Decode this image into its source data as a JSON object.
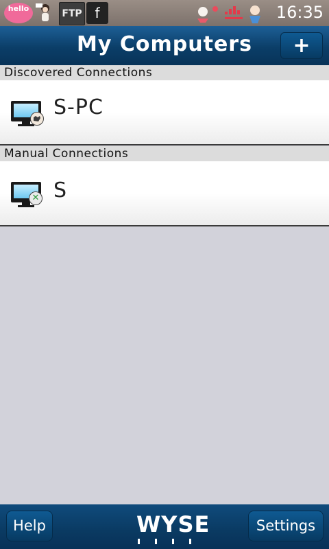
{
  "status_bar": {
    "time": "16:35",
    "icons": {
      "hello_text": "hello",
      "usb_icon": "usb-character-icon",
      "ftp_text": "FTP",
      "facebook_glyph": "f",
      "notification_icons": "notification-icons"
    }
  },
  "header": {
    "title": "My Computers",
    "add_label": "+"
  },
  "sections": {
    "discovered": {
      "label": "Discovered Connections",
      "items": [
        {
          "name": "S-PC",
          "icon": "monitor-remote-hand-icon"
        }
      ]
    },
    "manual": {
      "label": "Manual Connections",
      "items": [
        {
          "name": "S",
          "icon": "monitor-remote-x-icon"
        }
      ]
    }
  },
  "footer": {
    "help_label": "Help",
    "logo_text": "WYSE",
    "settings_label": "Settings"
  },
  "colors": {
    "header_blue": "#0b3e68",
    "background": "#d2d2da",
    "section_header": "#dcdcdc"
  }
}
